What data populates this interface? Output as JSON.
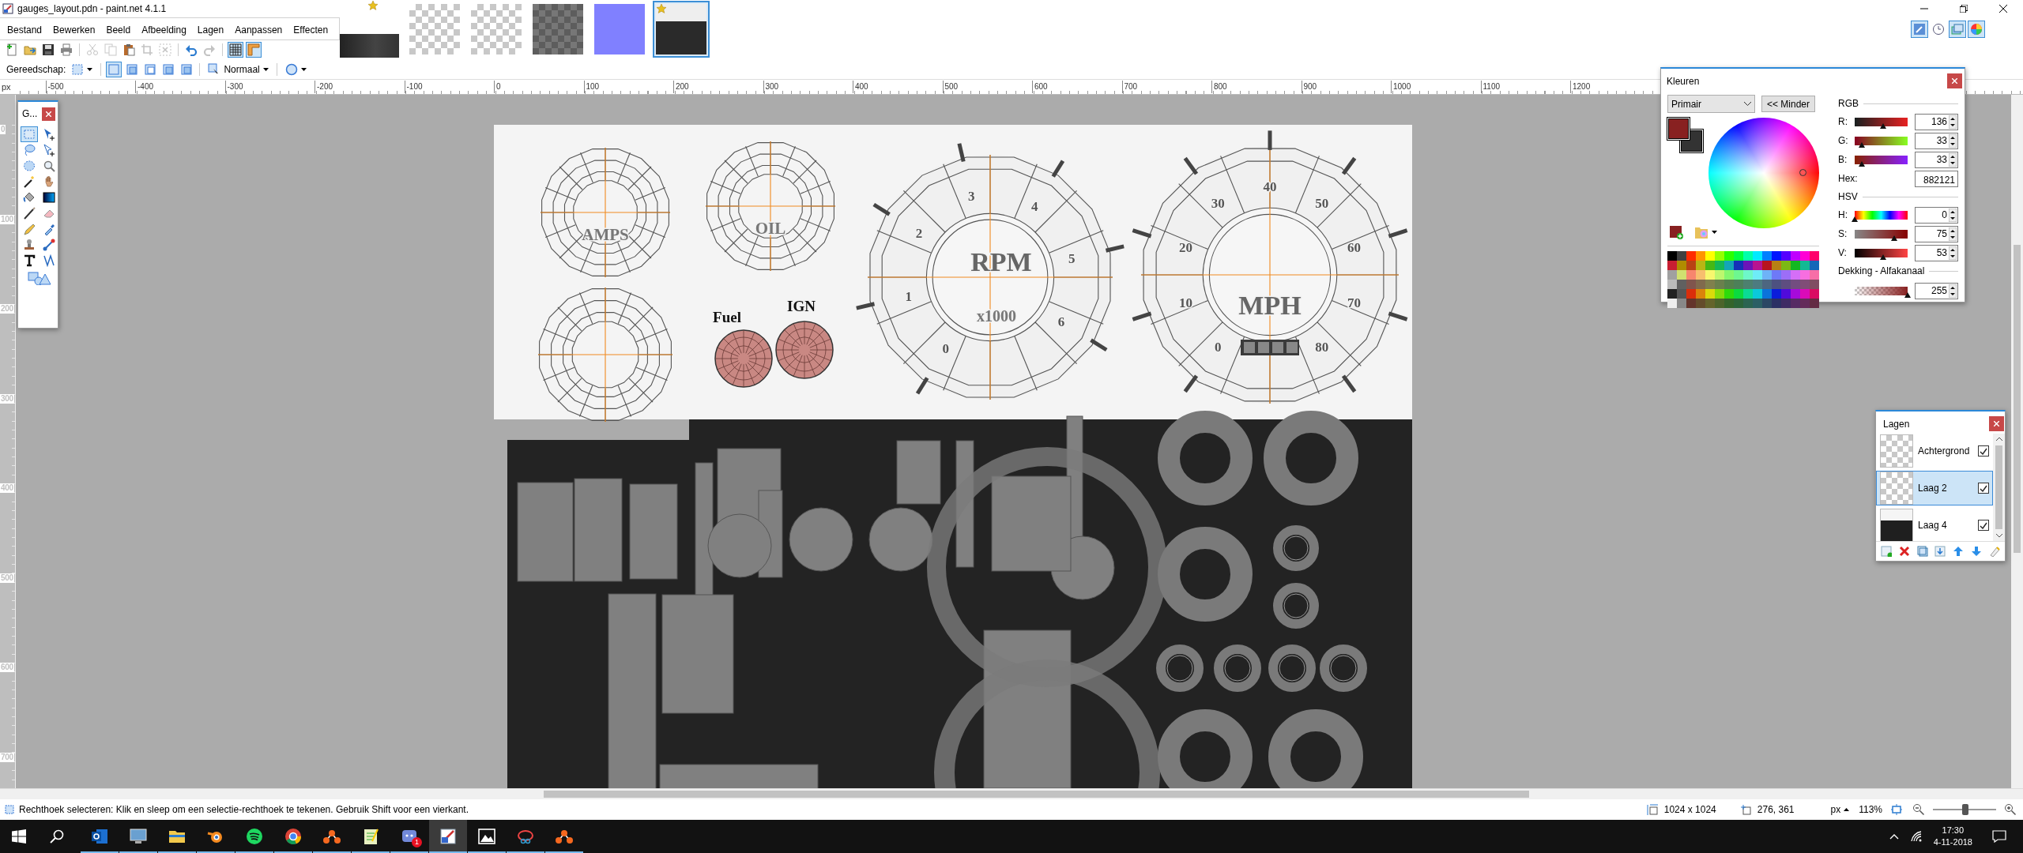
{
  "window": {
    "title": "gauges_layout.pdn - paint.net 4.1.1"
  },
  "menu": [
    "Bestand",
    "Bewerken",
    "Beeld",
    "Afbeelding",
    "Lagen",
    "Aanpassen",
    "Effecten"
  ],
  "images": [
    {
      "kind": "wide",
      "modified": true,
      "selected": false
    },
    {
      "kind": "checker",
      "modified": false,
      "selected": false
    },
    {
      "kind": "checker",
      "modified": false,
      "selected": false
    },
    {
      "kind": "grey",
      "modified": false,
      "selected": false
    },
    {
      "kind": "normal",
      "modified": false,
      "selected": false
    },
    {
      "kind": "gauges",
      "modified": true,
      "selected": true
    }
  ],
  "panel_toggles": [
    {
      "selected": true
    },
    {
      "selected": false
    },
    {
      "selected": true
    },
    {
      "selected": true
    }
  ],
  "toolbar": {
    "buttons": [
      {
        "disabled": false,
        "selected": false
      },
      {
        "disabled": false,
        "selected": false
      },
      {
        "disabled": false,
        "selected": false
      },
      {
        "disabled": false,
        "selected": false
      },
      {
        "disabled": true,
        "selected": false
      },
      {
        "disabled": true,
        "selected": false
      },
      {
        "disabled": false,
        "selected": false
      },
      {
        "disabled": true,
        "selected": false
      },
      {
        "disabled": true,
        "selected": false
      },
      {
        "disabled": false,
        "selected": false
      },
      {
        "disabled": true,
        "selected": false
      },
      {
        "disabled": false,
        "selected": true
      },
      {
        "disabled": false,
        "selected": true
      }
    ]
  },
  "tool_options": {
    "label": "Gereedschap:",
    "selection_modes": [
      {
        "selected": true
      },
      {
        "selected": false
      },
      {
        "selected": false
      },
      {
        "selected": false
      },
      {
        "selected": false
      }
    ],
    "blend_mode": "Normaal"
  },
  "rulers": {
    "unit": "px",
    "horizontal": [
      "-500",
      "-400",
      "-300",
      "-200",
      "-100",
      "0",
      "100",
      "200",
      "300",
      "400",
      "500",
      "600",
      "700",
      "800",
      "900",
      "1000",
      "1100",
      "1200"
    ],
    "vertical": [
      "0",
      "100",
      "200",
      "300",
      "400",
      "500",
      "600",
      "700"
    ]
  },
  "canvas": {
    "gauges": [
      {
        "kind": "small",
        "label": "AMPS"
      },
      {
        "kind": "small",
        "label": "OIL"
      },
      {
        "kind": "small"
      },
      {
        "kind": "knob",
        "label": "Fuel"
      },
      {
        "kind": "knob",
        "label": "IGN"
      },
      {
        "kind": "large",
        "label": "RPM",
        "sublabel": "x1000",
        "scale": [
          "0",
          "1",
          "2",
          "3",
          "4",
          "5",
          "6"
        ]
      },
      {
        "kind": "large",
        "label": "MPH",
        "scale": [
          "0",
          "10",
          "20",
          "30",
          "40",
          "50",
          "60",
          "70",
          "80"
        ]
      }
    ]
  },
  "tools_window": {
    "title": "G...",
    "tools": [
      {
        "selected": true
      },
      {
        "selected": false
      },
      {
        "selected": false
      },
      {
        "selected": false
      },
      {
        "selected": false
      },
      {
        "selected": false
      },
      {
        "selected": false
      },
      {
        "selected": false
      },
      {
        "selected": false
      },
      {
        "selected": false
      },
      {
        "selected": false
      },
      {
        "selected": false
      },
      {
        "selected": false
      },
      {
        "selected": false
      },
      {
        "selected": false
      },
      {
        "selected": false
      },
      {
        "selected": false
      },
      {
        "selected": false
      },
      {
        "selected": false
      }
    ]
  },
  "colors_window": {
    "title": "Kleuren",
    "target": "Primair",
    "toggle": "<< Minder",
    "swatches": [
      {
        "kind": "primary",
        "color": "#882121"
      },
      {
        "kind": "secondary",
        "color": "#333333"
      }
    ],
    "rgb_heading": "RGB",
    "rgb": [
      {
        "label": "R:",
        "value": "136",
        "level": 0.53
      },
      {
        "label": "G:",
        "value": "33",
        "level": 0.13
      },
      {
        "label": "B:",
        "value": "33",
        "level": 0.13
      }
    ],
    "hex_label": "Hex:",
    "hex": "882121",
    "hsv_heading": "HSV",
    "hsv": [
      {
        "label": "H:",
        "value": "0",
        "level": 0
      },
      {
        "label": "S:",
        "value": "75",
        "level": 0.75
      },
      {
        "label": "V:",
        "value": "53",
        "level": 0.53
      }
    ],
    "alpha_heading": "Dekking - Alfakanaal",
    "alpha": {
      "value": "255",
      "level": 1
    }
  },
  "layers_window": {
    "title": "Lagen",
    "layers": [
      {
        "name": "Achtergrond",
        "visible": true,
        "selected": false
      },
      {
        "name": "Laag 2",
        "visible": true,
        "selected": true
      },
      {
        "name": "Laag 4",
        "visible": true,
        "selected": false
      }
    ]
  },
  "status_bar": {
    "message": "Rechthoek selecteren: Klik en sleep om een selectie-rechthoek te tekenen. Gebruik Shift voor een vierkant.",
    "image_size": "1024 x 1024",
    "cursor_position": "276, 361",
    "unit": "px",
    "zoom": "113%",
    "zoom_slider": {
      "level": 0.52
    }
  },
  "taskbar": {
    "apps": [
      {
        "active": false
      },
      {
        "active": false
      },
      {
        "active": false
      },
      {
        "active": false
      },
      {
        "active": false
      },
      {
        "active": false
      },
      {
        "active": false
      },
      {
        "active": false
      },
      {
        "active": false,
        "badge": "1"
      },
      {
        "active": true
      },
      {
        "active": false
      },
      {
        "active": false
      },
      {
        "active": false
      }
    ],
    "time": "17:30",
    "date": "4-11-2018"
  }
}
